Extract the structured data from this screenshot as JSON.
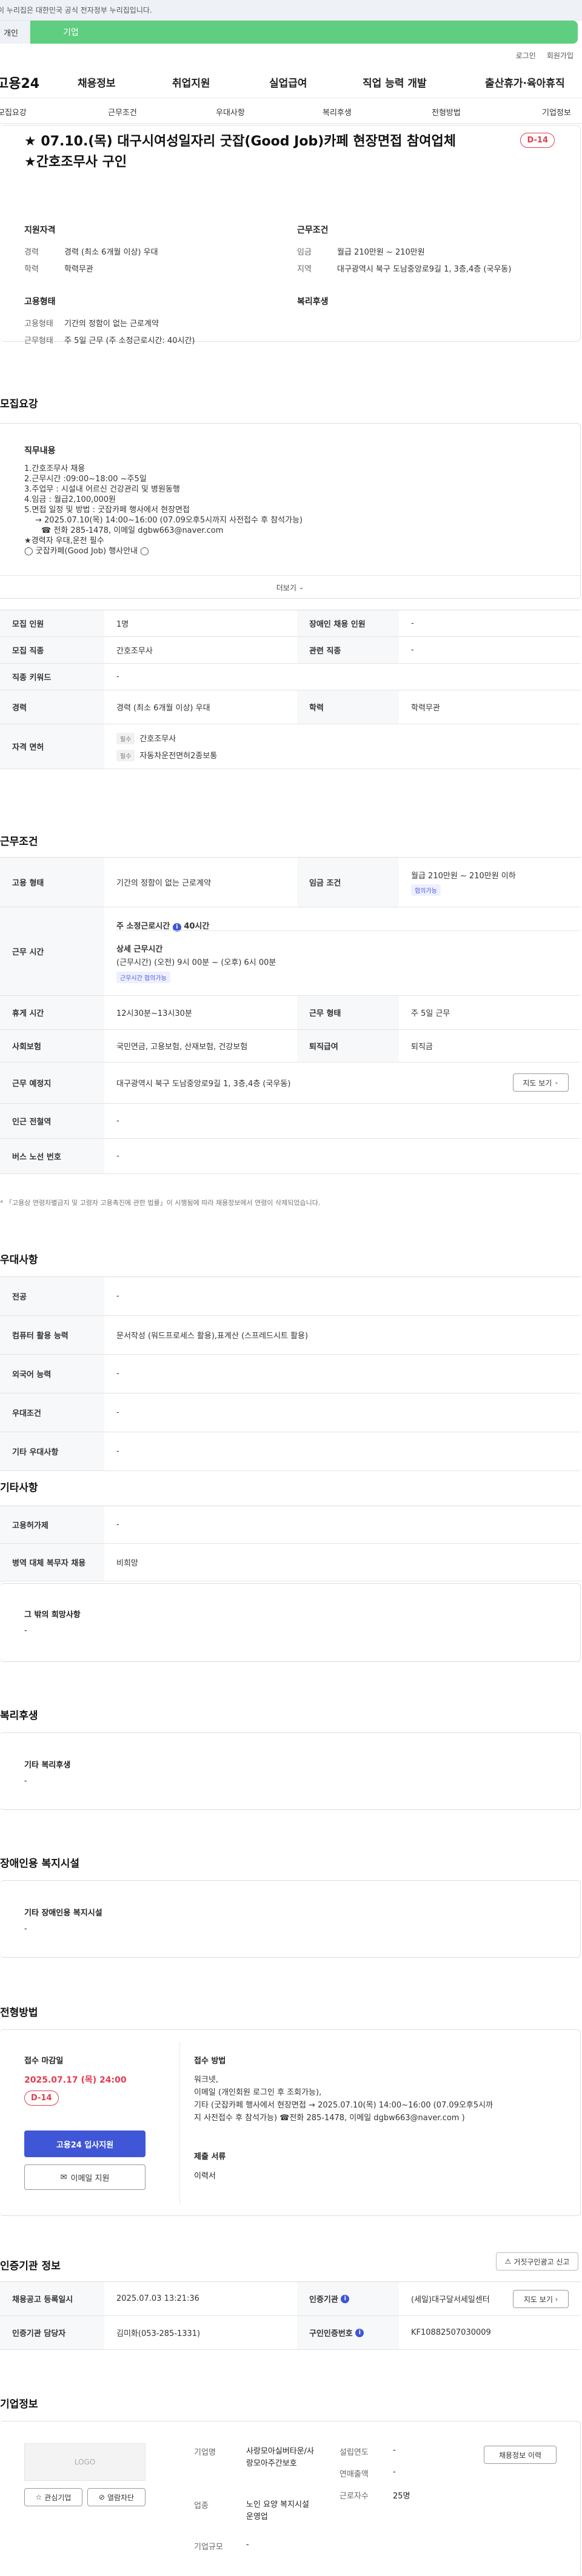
{
  "top": {
    "notice": "이 누리집은 대한민국 공식 전자정부 누리집입니다.",
    "tab_left": "개인",
    "tab_right": "기업"
  },
  "util": {
    "login": "로그인",
    "join": "회원가입"
  },
  "gnb": {
    "logo": "고용24",
    "menu": [
      "채용정보",
      "취업지원",
      "실업급여",
      "직업 능력 개발",
      "출산휴가·육아휴직"
    ]
  },
  "snb": [
    "모집요강",
    "근무조건",
    "우대사항",
    "복리후생",
    "전형방법",
    "기업정보"
  ],
  "hero": {
    "title": "★ 07.10.(목) 대구시여성일자리 굿잡(Good Job)카페 현장면접 참여업체 ★간호조무사 구인",
    "dday": "D-14",
    "qual_title": "지원자격",
    "qual": [
      {
        "k": "경력",
        "v": "경력 (최소 6개월 이상) 우대"
      },
      {
        "k": "학력",
        "v": "학력무관"
      }
    ],
    "cond_title": "근무조건",
    "cond": [
      {
        "k": "임금",
        "v": "월급 210만원 ~ 210만원"
      },
      {
        "k": "지역",
        "v": "대구광역시 북구 도남중앙로9길 1, 3층,4층 (국우동)"
      }
    ],
    "emp_title": "고용형태",
    "emp": [
      {
        "k": "고용형태",
        "v": "기간의 정함이 없는 근로계약"
      },
      {
        "k": "근무형태",
        "v": "주 5일 근무 (주 소정근로시간: 40시간)"
      }
    ],
    "welfare_title": "복리후생"
  },
  "recruit": {
    "title": "모집요강",
    "duty_title": "직무내용",
    "duty_lines": [
      "1.간호조무사 채용",
      "2.근무시간 :09:00~18:00 ~주5일",
      "3.주업무 : 시설내 어르신 건강관리 및 병원동행",
      "4.임금 : 월급2,100,000원",
      "5.면접 일정 및 방법 : 굿잡카페 행사에서 현장면접",
      "→ 2025.07.10(목) 14:00~16:00  (07.09오후5시까지 사전접수 후 참석가능)",
      "☎ 전화 285-1478, 이메일 dgbw663@naver.com",
      "★경력자 우대,운전 필수",
      "◯ 굿잡카페(Good Job) 행사안내 ◯"
    ],
    "more": "더보기",
    "rows": [
      {
        "h1": "모집 인원",
        "v1": "1명",
        "h2": "장애인 채용 인원",
        "v2": "-"
      },
      {
        "h1": "모집 직종",
        "v1": "간호조무사",
        "h2": "관련 직종",
        "v2": "-"
      },
      {
        "h1": "직종 키워드",
        "v1": "-"
      },
      {
        "h1": "경력",
        "v1": "경력 (최소 6개월 이상) 우대",
        "h2": "학력",
        "v2": "학력무관"
      }
    ],
    "license_h": "자격 면허",
    "license": [
      {
        "tag": "필수",
        "v": "간호조무사"
      },
      {
        "tag": "필수",
        "v": "자동차운전면허2종보통"
      }
    ]
  },
  "work": {
    "title": "근무조건",
    "emp_h": "고용 형태",
    "emp_v": "기간의 정함이 없는 근로계약",
    "wage_h": "임금 조건",
    "wage_v": "월급 210만원 ~ 210만원 이하",
    "wage_tag": "협의가능",
    "time_h": "근무 시간",
    "time_main": "주 소정근로시간",
    "time_hours": "40시간",
    "time_detail_t": "상세 근무시간",
    "time_detail": "(근무시간) (오전) 9시 00분 ~ (오후) 6시 00분",
    "time_tag": "근무시간 협의가능",
    "rest_h": "휴게 시간",
    "rest_v": "12시30분~13시30분",
    "shape_h": "근무 형태",
    "shape_v": "주 5일 근무",
    "ins_h": "사회보험",
    "ins_v": "국민연금, 고용보험, 산재보험, 건강보험",
    "ret_h": "퇴직급여",
    "ret_v": "퇴직금",
    "place_h": "근무 예정지",
    "place_v": "대구광역시 북구 도남중앙로9길 1, 3층,4층 (국우동)",
    "map": "지도 보기",
    "sub_h": "인근 전철역",
    "sub_v": "-",
    "bus_h": "버스 노선 번호",
    "bus_v": "-",
    "note": "* 「고용상 연령차별금지 및 고령자 고용촉진에 관한 법률」이 시행됨에 따라 채용정보에서 연령이 삭제되었습니다."
  },
  "pref": {
    "title": "우대사항",
    "rows": [
      {
        "h": "전공",
        "v": "-"
      },
      {
        "h": "컴퓨터 활용 능력",
        "v": "문서작성 (워드프로세스 활용),표계산 (스프레드시트 활용)"
      },
      {
        "h": "외국어 능력",
        "v": "-"
      },
      {
        "h": "우대조건",
        "v": "-"
      },
      {
        "h": "기타 우대사항",
        "v": "-"
      }
    ]
  },
  "etc": {
    "title": "기타사항",
    "rows": [
      {
        "h": "고용허가제",
        "v": "-"
      },
      {
        "h": "병역 대체 복무자 채용",
        "v": "비희망"
      }
    ],
    "hope_t": "그 밖의 희망사항",
    "hope_v": "-"
  },
  "welfare": {
    "title": "복리후생",
    "box_t": "기타 복리후생",
    "box_v": "-"
  },
  "disabled": {
    "title": "장애인용 복지시설",
    "box_t": "기타 장애인용 복지시설",
    "box_v": "-"
  },
  "process": {
    "title": "전형방법",
    "deadline_t": "접수 마감일",
    "deadline_v": "2025.07.17 (목) 24:00",
    "dday": "D-14",
    "apply": "고용24 입사지원",
    "email": "이메일 지원",
    "method_t": "접수 방법",
    "method_lines": [
      "워크넷,",
      "이메일 (개인회원 로그인 후 조회가능),",
      "기타 (굿잡카페 행사에서 현장면접      → 2025.07.10(목) 14:00~16:00  (07.09오후5시까",
      "지 사전접수 후 참석가능)      ☎전화 285-1478, 이메일 dgbw663@naver.com )"
    ],
    "docs_t": "제출 서류",
    "docs_v": "이력서"
  },
  "cert": {
    "title": "인증기관 정보",
    "report": "거짓구인광고 신고",
    "r1h1": "채용공고 등록일시",
    "r1v1": "2025.07.03 13:21:36",
    "r1h2": "인증기관",
    "r1v2": "(세일)대구달서세일센터",
    "map": "지도 보기",
    "r2h1": "인증기관 담당자",
    "r2v1": "김미화(053-285-1331)",
    "r2h2": "구인인증번호",
    "r2v2": "KF10882507030009"
  },
  "company": {
    "title": "기업정보",
    "logo": "LOGO",
    "fav": "관심기업",
    "block": "열람차단",
    "k_name": "기업명",
    "v_name": "사랑모아실버타운/사랑모아주간보호",
    "k_ind": "업종",
    "v_ind": "노인 요양 복지시설 운영업",
    "k_size": "기업규모",
    "v_size": "-",
    "k_est": "설립연도",
    "v_est": "-",
    "k_sales": "연매출액",
    "v_sales": "-",
    "k_emp": "근로자수",
    "v_emp": "25명",
    "jobs": "채용정보 이력"
  }
}
